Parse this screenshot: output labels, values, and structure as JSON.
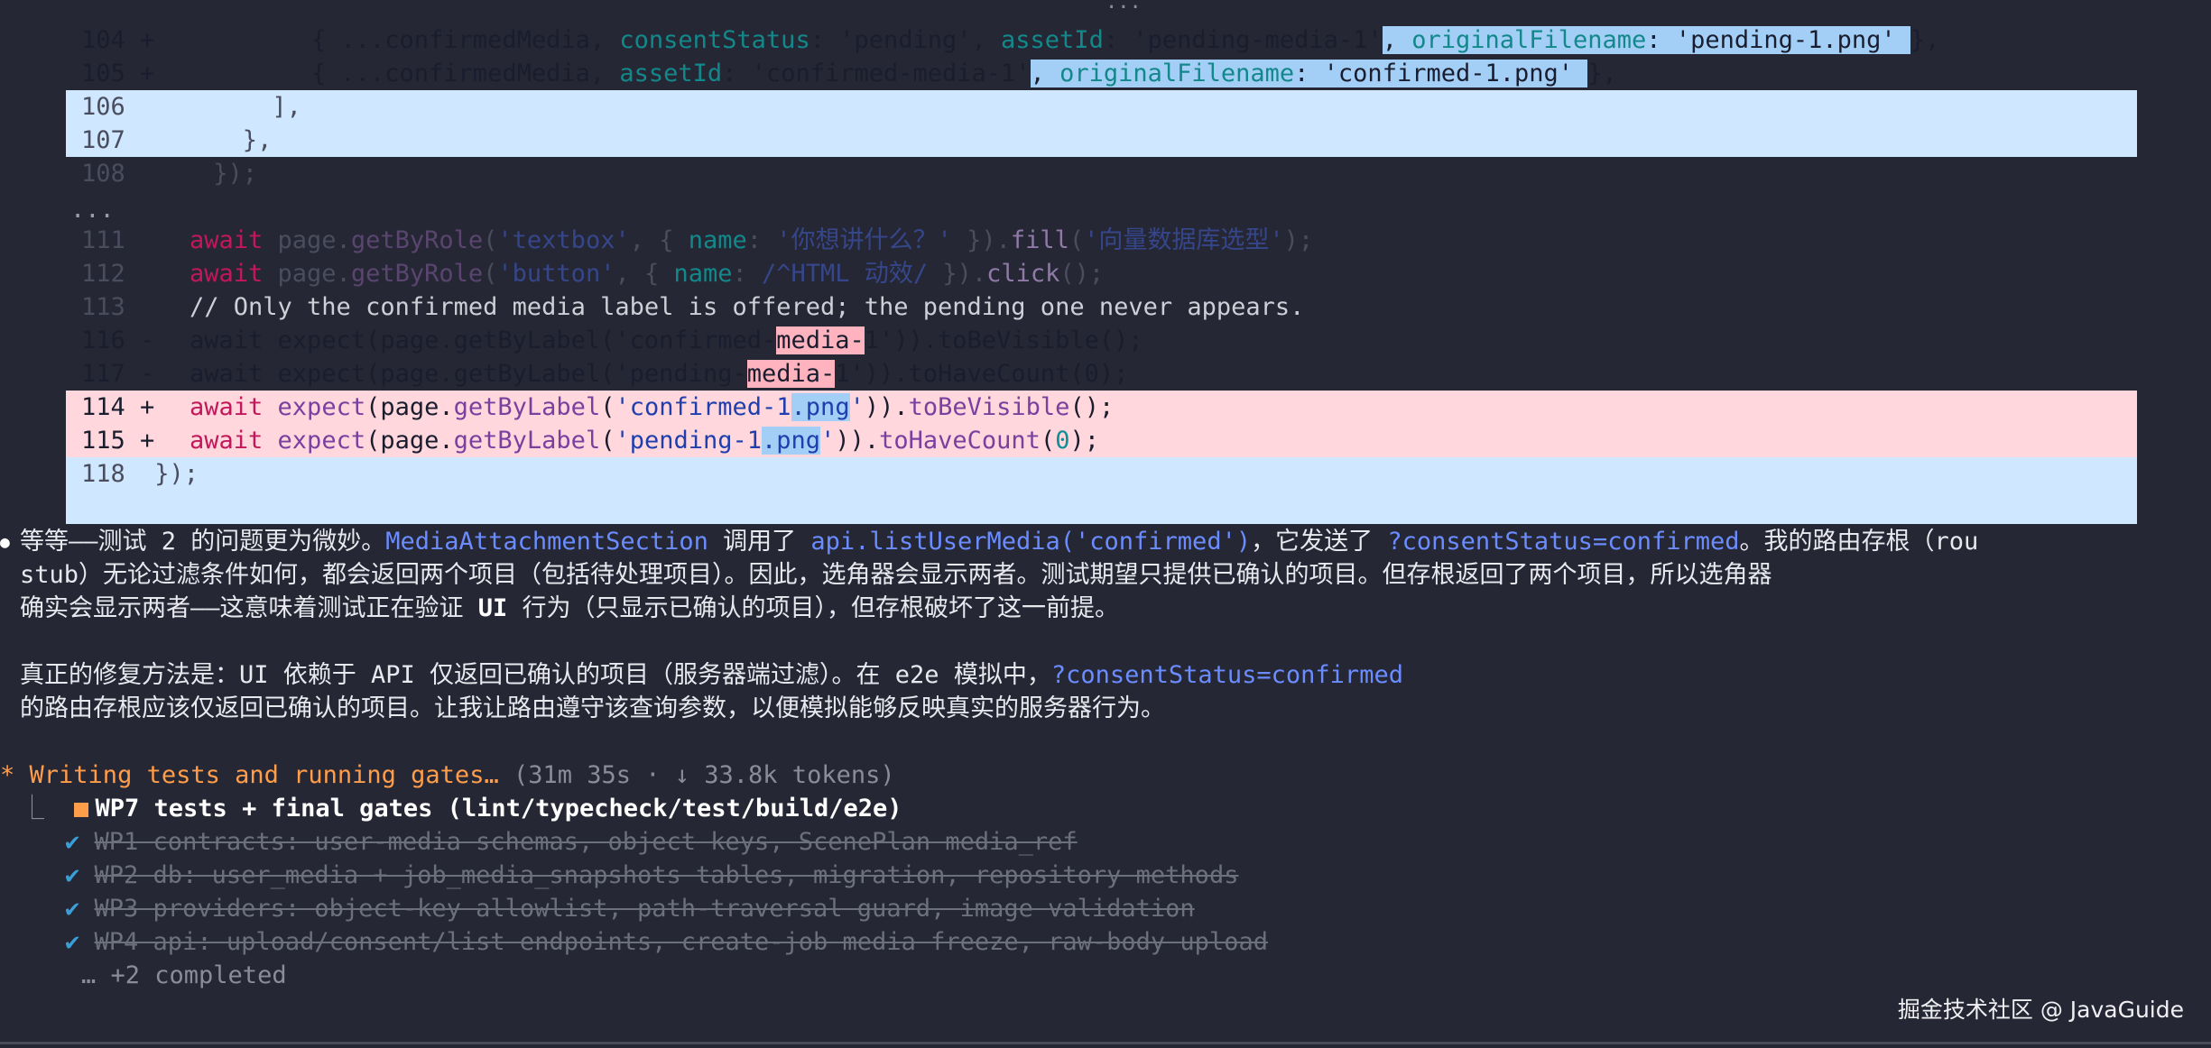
{
  "diff": {
    "top_ellipsis": "...",
    "line104_num": "104 +",
    "line104_a": "{ ...confirmedMedia, ",
    "line104_b": "consentStatus",
    "line104_c": ": 'pending', ",
    "line104_d": "assetId",
    "line104_e": ": 'pending-media-1'",
    "line104_f": ", ",
    "line104_g": "originalFilename",
    "line104_h": ": 'pending-1.png' ",
    "line104_i": "},",
    "line105_num": "105 +",
    "line105_a": "{ ...confirmedMedia, ",
    "line105_b": "assetId",
    "line105_c": ": 'confirmed-media-1'",
    "line105_d": ", ",
    "line105_e": "originalFilename",
    "line105_f": ": 'confirmed-1.png' ",
    "line105_g": "},",
    "line106": "106          ],",
    "line107": "107        },",
    "line108": "108      });",
    "mid_ellipsis": "...",
    "line111_num": "111",
    "line111_kw": "await",
    "line111_a": " page.",
    "line111_fn": "getByRole",
    "line111_b": "(",
    "line111_s1": "'textbox'",
    "line111_c": ", { ",
    "line111_p": "name",
    "line111_d": ": ",
    "line111_s2": "'你想讲什么？'",
    "line111_e": " }).",
    "line111_fn2": "fill",
    "line111_f": "(",
    "line111_s3": "'向量数据库选型'",
    "line111_g": ");",
    "line112_num": "112",
    "line112_kw": "await",
    "line112_a": " page.",
    "line112_fn": "getByRole",
    "line112_b": "(",
    "line112_s1": "'button'",
    "line112_c": ", { ",
    "line112_p": "name",
    "line112_d": ": ",
    "line112_s2": "/^HTML 动效/",
    "line112_e": " }).",
    "line112_fn2": "click",
    "line112_f": "();",
    "line113_num": "113",
    "line113_comment": "// Only the confirmed media label is offered; the pending one never appears.",
    "line116_num": "116 -",
    "line116_a": "await expect(page.getByLabel('confirmed-",
    "line116_hl": "media-",
    "line116_b": "1')).toBeVisible();",
    "line117_num": "117 -",
    "line117_a": "await expect(page.getByLabel('pending-",
    "line117_hl": "media-",
    "line117_b": "1')).toHaveCount(0);",
    "line114_num": "114 +",
    "line114_kw": "await",
    "line114_a": " ",
    "line114_fn1": "expect",
    "line114_b": "(page.",
    "line114_fn2": "getByLabel",
    "line114_c": "(",
    "line114_s1": "'confirmed-1",
    "line114_hl": ".png",
    "line114_s2": "'",
    "line114_d": ")).",
    "line114_fn3": "toBeVisible",
    "line114_e": "();",
    "line115_num": "115 +",
    "line115_kw": "await",
    "line115_a": " ",
    "line115_fn1": "expect",
    "line115_b": "(page.",
    "line115_fn2": "getByLabel",
    "line115_c": "(",
    "line115_s1": "'pending-1",
    "line115_hl": ".png",
    "line115_s2": "'",
    "line115_d": ")).",
    "line115_fn3": "toHaveCount",
    "line115_e": "(",
    "line115_n": "0",
    "line115_f": ");",
    "line118": "118  });"
  },
  "message": {
    "bullet": "●",
    "p1_l1_a": "等等——测试 2 的问题更为微妙。",
    "p1_l1_link1": "MediaAttachmentSection",
    "p1_l1_b": " 调用了 ",
    "p1_l1_link2": "api.listUserMedia('confirmed')",
    "p1_l1_c": "，它发送了 ",
    "p1_l1_link3": "?consentStatus=confirmed",
    "p1_l1_d": "。我的路由存根（rou",
    "p1_l2": "stub）无论过滤条件如何，都会返回两个项目（包括待处理项目）。因此，选角器会显示两者。测试期望只提供已确认的项目。但存根返回了两个项目，所以选角器",
    "p1_l3_a": "确实会显示两者——这意味着测试正在验证 ",
    "p1_l3_bold": "UI",
    "p1_l3_b": " 行为（只显示已确认的项目），但存根破坏了这一前提。",
    "p2_l1_a": "真正的修复方法是：UI 依赖于 API 仅返回已确认的项目（服务器端过滤）。在 e2e 模拟中，",
    "p2_l1_link": "?consentStatus=confirmed",
    "p2_l2": "的路由存根应该仅返回已确认的项目。让我让路由遵守该查询参数，以便模拟能够反映真实的服务器行为。"
  },
  "status": {
    "spinner": "*",
    "label": "Writing tests and running gates…",
    "meta": " (31m 35s · ↓ 33.8k tokens)",
    "tree_char": "⎿",
    "current_task": "WP7 tests + final gates (lint/typecheck/test/build/e2e)",
    "check": "✔",
    "tasks": [
      "WP1 contracts: user-media schemas, object keys, ScenePlan media_ref",
      "WP2 db: user_media + job_media_snapshots tables, migration, repository methods",
      "WP3 providers: object-key allowlist, path-traversal guard, image validation",
      "WP4 api: upload/consent/list endpoints, create-job media freeze, raw-body upload"
    ],
    "more": "… +2 completed"
  },
  "watermark": "掘金技术社区 @ JavaGuide"
}
